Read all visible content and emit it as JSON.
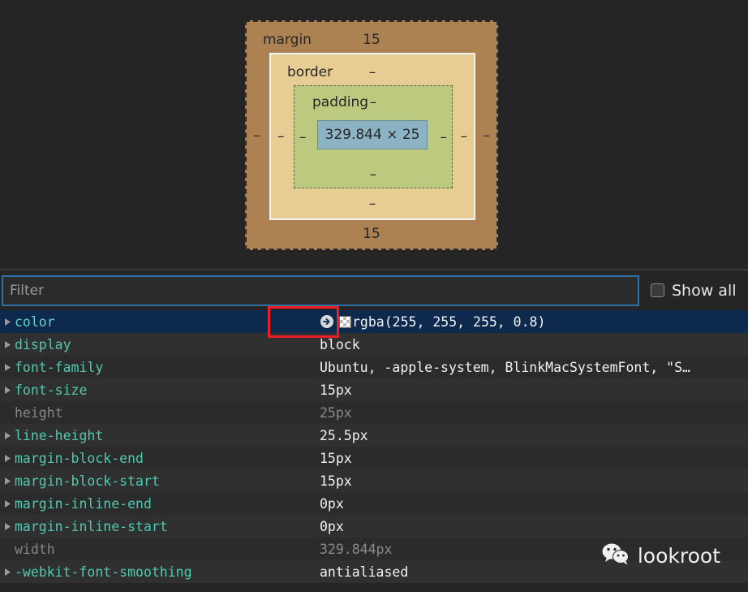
{
  "box_model": {
    "margin": {
      "label": "margin",
      "top": "15",
      "right": "–",
      "bottom": "15",
      "left": "–"
    },
    "border": {
      "label": "border",
      "top": "–",
      "right": "–",
      "bottom": "–",
      "left": "–"
    },
    "padding": {
      "label": "padding",
      "top": "–",
      "right": "–",
      "bottom": "–",
      "left": "–"
    },
    "content": {
      "dimensions": "329.844 × 25"
    },
    "colors": {
      "margin": "#ad8253",
      "border": "#e7cd93",
      "padding": "#bcca7f",
      "content": "#8cb3c4"
    }
  },
  "filter": {
    "placeholder": "Filter",
    "value": "",
    "show_all_label": "Show all",
    "show_all_checked": false
  },
  "properties": [
    {
      "name": "color",
      "value": "rgba(255, 255, 255, 0.8)",
      "dim": false,
      "selected": true,
      "has_goto_icon": true,
      "has_swatch": true
    },
    {
      "name": "display",
      "value": "block",
      "dim": false,
      "selected": false,
      "has_goto_icon": false,
      "has_swatch": false
    },
    {
      "name": "font-family",
      "value": "Ubuntu, -apple-system, BlinkMacSystemFont, \"S…",
      "dim": false,
      "selected": false,
      "has_goto_icon": false,
      "has_swatch": false
    },
    {
      "name": "font-size",
      "value": "15px",
      "dim": false,
      "selected": false,
      "has_goto_icon": false,
      "has_swatch": false
    },
    {
      "name": "height",
      "value": "25px",
      "dim": true,
      "selected": false,
      "has_goto_icon": false,
      "has_swatch": false
    },
    {
      "name": "line-height",
      "value": "25.5px",
      "dim": false,
      "selected": false,
      "has_goto_icon": false,
      "has_swatch": false
    },
    {
      "name": "margin-block-end",
      "value": "15px",
      "dim": false,
      "selected": false,
      "has_goto_icon": false,
      "has_swatch": false
    },
    {
      "name": "margin-block-start",
      "value": "15px",
      "dim": false,
      "selected": false,
      "has_goto_icon": false,
      "has_swatch": false
    },
    {
      "name": "margin-inline-end",
      "value": "0px",
      "dim": false,
      "selected": false,
      "has_goto_icon": false,
      "has_swatch": false
    },
    {
      "name": "margin-inline-start",
      "value": "0px",
      "dim": false,
      "selected": false,
      "has_goto_icon": false,
      "has_swatch": false
    },
    {
      "name": "width",
      "value": "329.844px",
      "dim": true,
      "selected": false,
      "has_goto_icon": false,
      "has_swatch": false
    },
    {
      "name": "-webkit-font-smoothing",
      "value": "antialiased",
      "dim": false,
      "selected": false,
      "has_goto_icon": false,
      "has_swatch": false
    }
  ],
  "annotation": {
    "color": "#ee1c25"
  },
  "watermark": {
    "text": "lookroot"
  }
}
